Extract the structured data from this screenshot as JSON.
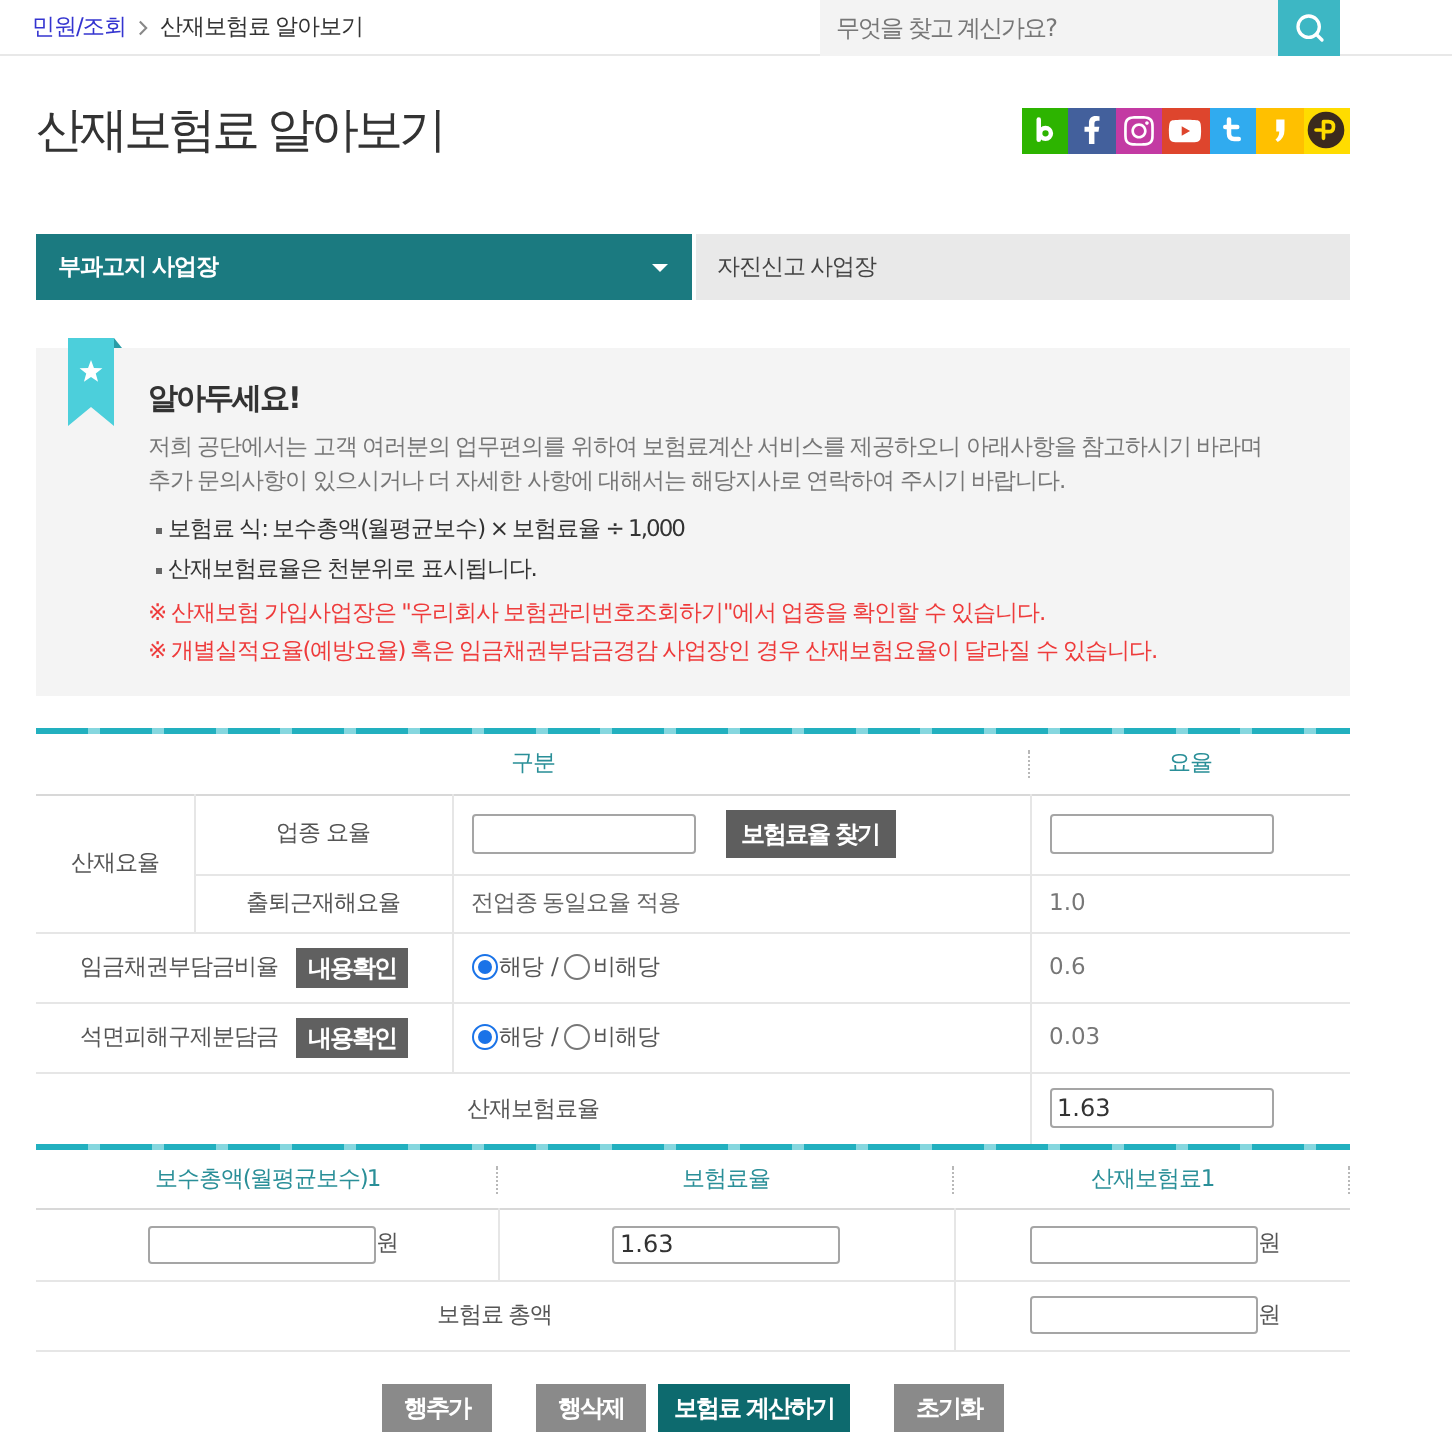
{
  "breadcrumb": [
    {
      "label": "민원/조회",
      "kind": "link"
    },
    {
      "label": "산재보험료 알아보기",
      "kind": "current"
    }
  ],
  "search": {
    "placeholder": "무엇을 찾고 계신가요?"
  },
  "page_title": "산재보험료 알아보기",
  "share_icons": [
    {
      "kind": "band",
      "color": "#2db400"
    },
    {
      "kind": "facebook",
      "color": "#43609c"
    },
    {
      "kind": "instagram",
      "color": "#c33aa3"
    },
    {
      "kind": "youtube",
      "color": "#de452d"
    },
    {
      "kind": "twitter",
      "color": "#30abef"
    },
    {
      "kind": "comma",
      "color": "#ffc000"
    },
    {
      "kind": "p_circle",
      "color": "#ffdc00"
    }
  ],
  "tabs": [
    {
      "label": "부과고지 사업장",
      "selected": true
    },
    {
      "label": "자진신고 사업장",
      "selected": false
    }
  ],
  "notice": {
    "title": "알아두세요!",
    "intro_lines": [
      "저희 공단에서는 고객 여러분의 업무편의를 위하여 보험료계산 서비스를 제공하오니 아래사항을 참고하시기 바라며",
      "추가 문의사항이 있으시거나 더 자세한 사항에 대해서는 해당지사로 연락하여 주시기 바랍니다."
    ],
    "bullets": [
      "보험료 식: 보수총액(월평균보수) × 보험료율 ÷ 1,000",
      "산재보험료율은 천분위로 표시됩니다."
    ],
    "warnings": [
      "※ 산재보험 가입사업장은 \"우리회사 보험관리번호조회하기\"에서 업종을 확인할 수 있습니다.",
      "※ 개별실적요율(예방요율) 혹은 임금채권부담금경감 사업장인 경우 산재보험요율이 달라질 수 있습니다."
    ]
  },
  "rate_table": {
    "columns": [
      "구분",
      "요율"
    ],
    "sections": [
      {
        "kind": "group",
        "label": "산재요율",
        "rows": [
          {
            "kind": "input",
            "label": "업종 요율",
            "button": "보험료율 찾기"
          },
          {
            "kind": "text",
            "label": "출퇴근재해요율",
            "detail": "전업종 동일요율 적용",
            "rate": "1.0"
          }
        ]
      },
      {
        "kind": "radio",
        "label": "임금채권부담금비율",
        "button": "내용확인",
        "options": [
          {
            "label": "해당",
            "selected": true
          },
          {
            "label": "비해당",
            "selected": false
          }
        ],
        "separator": "/",
        "rate": "0.6"
      },
      {
        "kind": "radio",
        "label": "석면피해구제분담금",
        "button": "내용확인",
        "options": [
          {
            "label": "해당",
            "selected": true
          },
          {
            "label": "비해당",
            "selected": false
          }
        ],
        "separator": "/",
        "rate": "0.03"
      },
      {
        "kind": "total",
        "label": "산재보험료율",
        "rate_value": "1.63"
      }
    ]
  },
  "premium_table": {
    "columns": [
      "보수총액(월평균보수)1",
      "보험료율",
      "산재보험료1"
    ],
    "rows": [
      {
        "kind": "entry",
        "wage_unit": "원",
        "rate_value": "1.63",
        "premium_unit": "원"
      },
      {
        "kind": "total",
        "label": "보험료 총액",
        "unit": "원"
      }
    ]
  },
  "actions": [
    {
      "label": "행추가",
      "kind": "secondary"
    },
    {
      "label": "행삭제",
      "kind": "secondary"
    },
    {
      "label": "보험료 계산하기",
      "kind": "primary"
    },
    {
      "label": "초기화",
      "kind": "secondary"
    }
  ]
}
